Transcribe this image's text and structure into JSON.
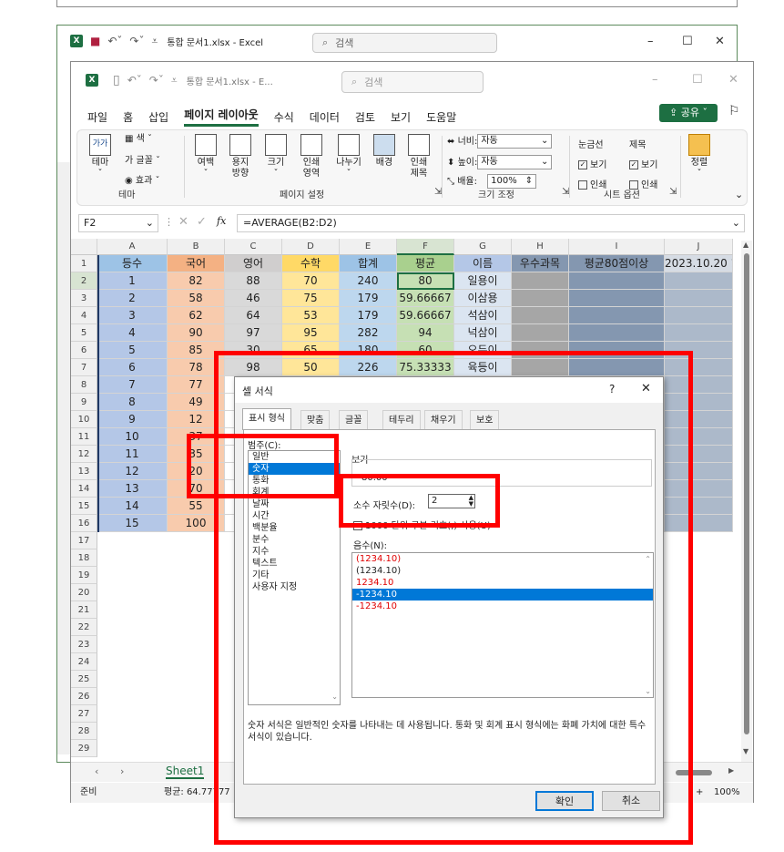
{
  "top_strip": {
    "text": "…"
  },
  "back_window": {
    "title": "통합 문서1.xlsx  -  Excel",
    "search_placeholder": "검색",
    "minimize": "–",
    "maximize": "☐",
    "close": "✕"
  },
  "front_window": {
    "title": "통합 문서1.xlsx  -  E...",
    "search_placeholder": "검색",
    "minimize": "–",
    "maximize": "☐",
    "close": "✕",
    "tabs": [
      "파일",
      "홈",
      "삽입",
      "페이지 레이아웃",
      "수식",
      "데이터",
      "검토",
      "보기",
      "도움말"
    ],
    "active_tab": "페이지 레이아웃",
    "share_label": "공유",
    "ribbon": {
      "theme_btn": "테마",
      "colors": "색",
      "fonts": "글꼴",
      "effects": "효과",
      "group_theme": "테마",
      "margins": "여백",
      "orientation": "용지\n방향",
      "size": "크기",
      "print_area": "인쇄\n영역",
      "breaks": "나누기",
      "background": "배경",
      "print_titles": "인쇄\n제목",
      "group_page_setup": "페이지 설정",
      "width_label": "너비:",
      "width_value": "자동",
      "height_label": "높이:",
      "height_value": "자동",
      "scale_label": "배율:",
      "scale_value": "100%",
      "group_scale": "크기 조정",
      "gridlines": "눈금선",
      "headings": "제목",
      "view": "보기",
      "print": "인쇄",
      "group_sheet_options": "시트 옵션",
      "arrange": "정렬"
    },
    "name_box": "F2",
    "formula": "=AVERAGE(B2:D2)",
    "fx": "fx",
    "columns": [
      "A",
      "B",
      "C",
      "D",
      "E",
      "F",
      "G",
      "H",
      "I",
      "J"
    ],
    "header_row": [
      "등수",
      "국어",
      "영어",
      "수학",
      "합계",
      "평균",
      "이름",
      "우수과목",
      "평균80점이상",
      "2023.10.20 1"
    ],
    "rows": [
      [
        "1",
        "82",
        "88",
        "70",
        "240",
        "80",
        "일용이"
      ],
      [
        "2",
        "58",
        "46",
        "75",
        "179",
        "59.66667",
        "이삼용"
      ],
      [
        "3",
        "62",
        "64",
        "53",
        "179",
        "59.66667",
        "석삼이"
      ],
      [
        "4",
        "90",
        "97",
        "95",
        "282",
        "94",
        "넉삼이"
      ],
      [
        "5",
        "85",
        "30",
        "65",
        "180",
        "60",
        "오두이"
      ],
      [
        "6",
        "78",
        "98",
        "50",
        "226",
        "75.33333",
        "육등이"
      ],
      [
        "7",
        "77",
        "",
        "",
        "",
        "",
        ""
      ],
      [
        "8",
        "49",
        "",
        "",
        "",
        "",
        ""
      ],
      [
        "9",
        "12",
        "",
        "",
        "",
        "",
        ""
      ],
      [
        "10",
        "37",
        "",
        "",
        "",
        "",
        ""
      ],
      [
        "11",
        "35",
        "",
        "",
        "",
        "",
        ""
      ],
      [
        "12",
        "20",
        "",
        "",
        "",
        "",
        ""
      ],
      [
        "13",
        "70",
        "",
        "",
        "",
        "",
        ""
      ],
      [
        "14",
        "55",
        "",
        "",
        "",
        "",
        ""
      ],
      [
        "15",
        "100",
        "",
        "",
        "",
        "",
        ""
      ]
    ],
    "row_numbers": [
      "1",
      "2",
      "3",
      "4",
      "5",
      "6",
      "7",
      "8",
      "9",
      "10",
      "11",
      "12",
      "13",
      "14",
      "15",
      "16",
      "17",
      "18",
      "19",
      "20",
      "21",
      "22",
      "23",
      "24",
      "25",
      "26",
      "27",
      "28",
      "29"
    ],
    "sheet_tab": "Sheet1",
    "status_ready": "준비",
    "status_avg": "평균: 64.77777",
    "zoom": "100%"
  },
  "dialog": {
    "title": "셀 서식",
    "help": "?",
    "close": "✕",
    "tabs": [
      "표시 형식",
      "맞춤",
      "글꼴",
      "테두리",
      "채우기",
      "보호"
    ],
    "category_label": "범주(C):",
    "categories": [
      "일반",
      "숫자",
      "통화",
      "회계",
      "날짜",
      "시간",
      "백분율",
      "분수",
      "지수",
      "텍스트",
      "기타",
      "사용자 지정"
    ],
    "selected_category": "숫자",
    "sample_label": "보기",
    "sample_value": "80.00",
    "decimal_label": "소수 자릿수(D):",
    "decimal_value": "2",
    "thousands_label": "1000 단위 구분 기호(,) 사용(U)",
    "negative_label": "음수(N):",
    "negatives": [
      "(1234.10)",
      "(1234.10)",
      "1234.10",
      "-1234.10",
      "-1234.10"
    ],
    "negative_colors": [
      "#e00000",
      "#222222",
      "#e00000",
      "#ffffff",
      "#e00000"
    ],
    "selected_negative_index": 3,
    "description": "숫자 서식은 일반적인 숫자를 나타내는 데 사용됩니다. 통화 및 회계 표시 형식에는 화폐 가치에 대한 특수 서식이 있습니다.",
    "ok": "확인",
    "cancel": "취소"
  }
}
